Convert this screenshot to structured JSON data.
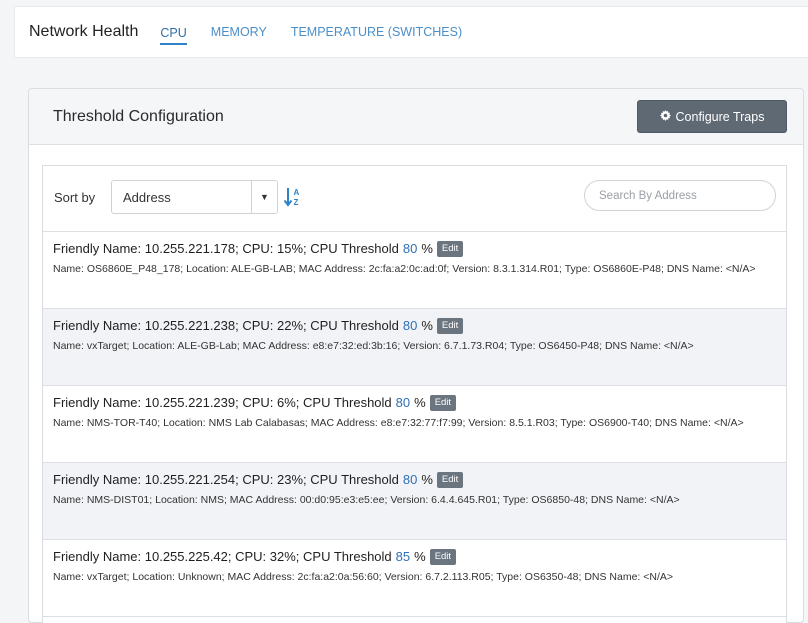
{
  "header": {
    "title": "Network Health",
    "tabs": [
      {
        "label": "CPU",
        "active": true
      },
      {
        "label": "MEMORY",
        "active": false
      },
      {
        "label": "TEMPERATURE (SWITCHES)",
        "active": false
      }
    ]
  },
  "card": {
    "title": "Threshold Configuration",
    "configure_button": "Configure Traps",
    "configure_icon": "gear-icon"
  },
  "toolbar": {
    "sort_label": "Sort by",
    "sort_value": "Address",
    "search_placeholder": "Search By Address"
  },
  "items": [
    {
      "main": "Friendly Name: 10.255.221.178; CPU: 15%; CPU Threshold",
      "threshold": "80",
      "pct": "%",
      "edit": "Edit",
      "detail": "Name: OS6860E_P48_178; Location: ALE-GB-LAB; MAC Address: 2c:fa:a2:0c:ad:0f; Version: 8.3.1.314.R01; Type: OS6860E-P48; DNS Name: <N/A>"
    },
    {
      "main": "Friendly Name: 10.255.221.238; CPU: 22%; CPU Threshold",
      "threshold": "80",
      "pct": "%",
      "edit": "Edit",
      "detail": "Name: vxTarget; Location: ALE-GB-Lab; MAC Address: e8:e7:32:ed:3b:16; Version: 6.7.1.73.R04; Type: OS6450-P48; DNS Name: <N/A>"
    },
    {
      "main": "Friendly Name: 10.255.221.239; CPU: 6%; CPU Threshold",
      "threshold": "80",
      "pct": "%",
      "edit": "Edit",
      "detail": "Name: NMS-TOR-T40; Location: NMS Lab Calabasas; MAC Address: e8:e7:32:77:f7:99; Version: 8.5.1.R03; Type: OS6900-T40; DNS Name: <N/A>"
    },
    {
      "main": "Friendly Name: 10.255.221.254; CPU: 23%; CPU Threshold",
      "threshold": "80",
      "pct": "%",
      "edit": "Edit",
      "detail": "Name: NMS-DIST01; Location: NMS; MAC Address: 00:d0:95:e3:e5:ee; Version: 6.4.4.645.R01; Type: OS6850-48; DNS Name: <N/A>"
    },
    {
      "main": "Friendly Name: 10.255.225.42; CPU: 32%; CPU Threshold",
      "threshold": "85",
      "pct": "%",
      "edit": "Edit",
      "detail": "Name: vxTarget; Location: Unknown; MAC Address: 2c:fa:a2:0a:56:60; Version: 6.7.2.113.R05; Type: OS6350-48; DNS Name: <N/A>"
    }
  ]
}
